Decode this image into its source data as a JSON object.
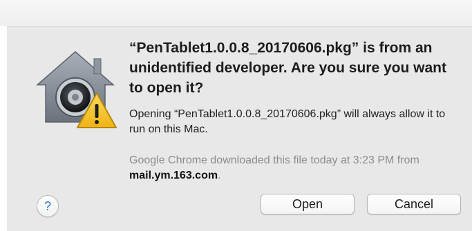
{
  "dialog": {
    "headline": "“PenTablet1.0.0.8_20170606.pkg” is from an unidentified developer. Are you sure you want to open it?",
    "info": "Opening “PenTablet1.0.0.8_20170606.pkg” will always allow it to run on this Mac.",
    "source_prefix": "Google Chrome downloaded this file today at 3:23 PM from ",
    "source_domain": "mail.ym.163.com",
    "source_suffix": ".",
    "icon": "gatekeeper-warning-icon"
  },
  "buttons": {
    "help_label": "?",
    "open_label": "Open",
    "cancel_label": "Cancel"
  },
  "colors": {
    "dialog_background": "#e8e8e8",
    "warning_yellow": "#f6c32a",
    "help_blue": "#2f74d0"
  }
}
